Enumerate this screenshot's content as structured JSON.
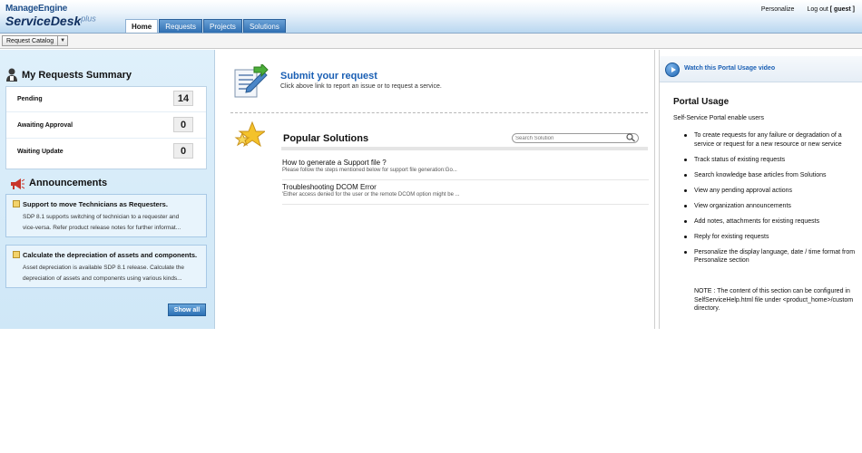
{
  "header": {
    "logo_top": "ManageEngine",
    "logo_main": "ServiceDesk",
    "logo_plus": "plus",
    "tabs": [
      "Home",
      "Requests",
      "Projects",
      "Solutions"
    ],
    "personalize": "Personalize",
    "logout": "Log out",
    "user": "[ guest ]"
  },
  "subbar": {
    "catalog_label": "Request Catalog"
  },
  "summary": {
    "title": "My Requests Summary",
    "rows": [
      {
        "label": "Pending",
        "count": "14"
      },
      {
        "label": "Awaiting Approval",
        "count": "0"
      },
      {
        "label": "Waiting Update",
        "count": "0"
      }
    ]
  },
  "announcements": {
    "title": "Announcements",
    "items": [
      {
        "title": "Support to move Technicians as Requesters.",
        "line1": "SDP 8.1 supports switching of technician to a requester and",
        "line2": "vice-versa. Refer product release notes for further informat..."
      },
      {
        "title": "Calculate the depreciation of assets and components.",
        "line1": "Asset depreciation is available SDP 8.1 release. Calculate the",
        "line2": "depreciation of assets and components using various kinds..."
      }
    ],
    "show_all": "Show all"
  },
  "submit": {
    "title": "Submit your request",
    "subtitle": "Click above link to report an issue or to request a service."
  },
  "solutions": {
    "title": "Popular Solutions",
    "search_placeholder": "Search Solution",
    "items": [
      {
        "title": "How to generate a Support file ?",
        "desc": "Please follow the steps mentioned below for support file generation:Go..."
      },
      {
        "title": "Troubleshooting DCOM Error",
        "desc": "'Either access denied for the user or the remote DCOM option might be ..."
      }
    ]
  },
  "portal": {
    "video_link": "Watch this Portal Usage video",
    "title": "Portal Usage",
    "intro": "Self-Service Portal enable users",
    "items": [
      "To create requests for any failure or degradation of a service or request for a new resource or new service",
      "Track status of existing requests",
      "Search knowledge base articles from Solutions",
      "View any pending approval actions",
      "View organization announcements",
      "Add notes, attachments for existing requests",
      "Reply for existing requests",
      "Personalize the display language, date / time format from Personalize section"
    ],
    "note": "NOTE : The content of this section can be configured in SelfServiceHelp.html file under <product_home>/custom directory."
  }
}
